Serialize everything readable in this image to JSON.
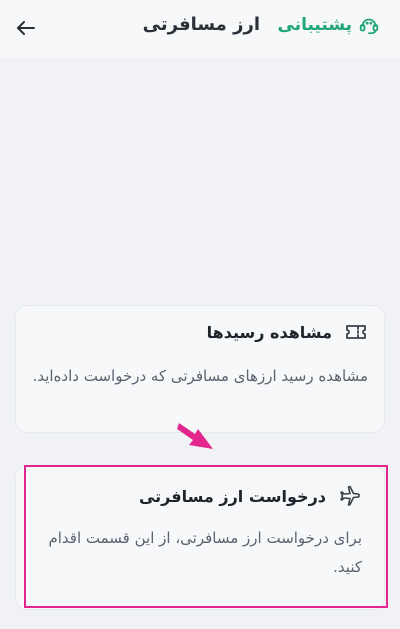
{
  "header": {
    "title": "ارز مسافرتی",
    "support_label": "پشتیبانی"
  },
  "cards": [
    {
      "title": "مشاهده رسیدها",
      "description": "مشاهده رسید ارزهای مسافرتی که درخواست داده‌اید.",
      "icon": "ticket-icon"
    },
    {
      "title": "درخواست ارز مسافرتی",
      "description": "برای درخواست ارز مسافرتی، از این قسمت اقدام کنید.",
      "icon": "airplane-icon"
    }
  ],
  "colors": {
    "accent": "#21a67a",
    "highlight": "#e3268e",
    "background": "#f0f2f5"
  }
}
